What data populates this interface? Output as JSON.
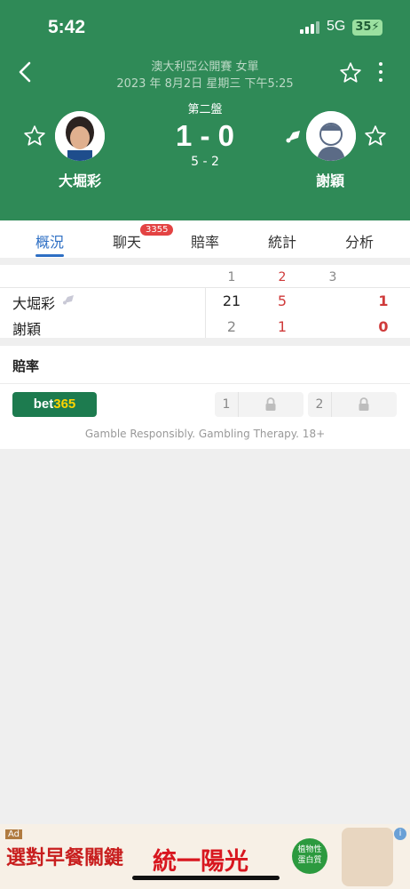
{
  "status_bar": {
    "time": "5:42",
    "network": "5G",
    "battery": "35"
  },
  "header": {
    "tournament": "澳大利亞公開賽 女單",
    "datetime": "2023 年 8月2日 星期三 下午5:25",
    "set_label": "第二盤",
    "score": "1 - 0",
    "game_score": "5 - 2",
    "player1": {
      "name": "大堀彩"
    },
    "player2": {
      "name": "謝穎"
    }
  },
  "tabs": [
    {
      "label": "概況",
      "active": true
    },
    {
      "label": "聊天",
      "badge": "3355"
    },
    {
      "label": "賠率"
    },
    {
      "label": "統計"
    },
    {
      "label": "分析"
    }
  ],
  "scoreboard": {
    "headers": [
      "1",
      "2",
      "3"
    ],
    "rows": [
      {
        "name": "大堀彩",
        "sets": [
          "21",
          "5",
          ""
        ],
        "total": "1"
      },
      {
        "name": "謝穎",
        "sets": [
          "2",
          "1",
          ""
        ],
        "total": "0"
      }
    ]
  },
  "odds": {
    "title": "賠率",
    "bookmaker_main": "bet",
    "bookmaker_accent": "365",
    "options": [
      "1",
      "2"
    ],
    "disclaimer": "Gamble Responsibly. Gambling Therapy. 18+"
  },
  "ad": {
    "tag": "Ad",
    "headline": "選對早餐關鍵",
    "brand": "統一陽光",
    "badge_line1": "植物性",
    "badge_line2": "蛋白質"
  },
  "colors": {
    "header_green": "#2f8a57",
    "accent_blue": "#2e6fc4",
    "score_red": "#cf3a3a",
    "badge_red": "#e34343"
  },
  "icons": [
    "back-icon",
    "star-icon",
    "more-icon",
    "shuttlecock-icon",
    "lock-icon",
    "info-icon"
  ]
}
